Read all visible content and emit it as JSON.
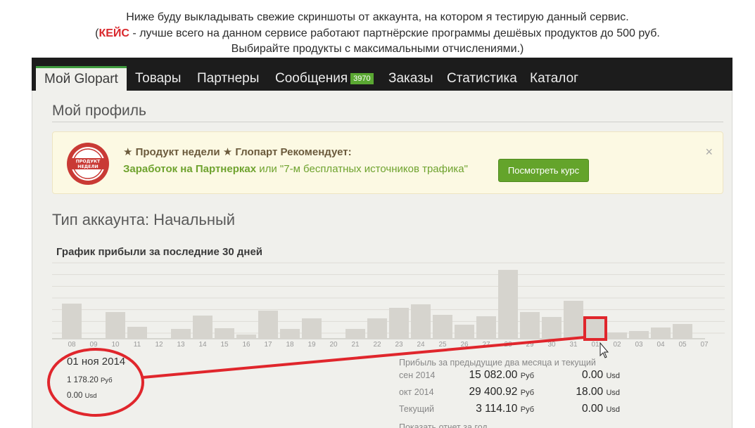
{
  "intro": {
    "line1": "Ниже буду выкладывать свежие скриншоты от аккаунта, на котором я тестирую данный сервис.",
    "line2_prefix": "(",
    "line2_keyword": "КЕЙС",
    "line2_rest": " - лучше всего на данном сервисе работают партнёрские программы дешёвых продуктов до 500 руб.",
    "line3": "Выбирайте продукты с максимальными отчислениями.)"
  },
  "nav": {
    "tabs": [
      {
        "label": "Мой Glopart",
        "active": true
      },
      {
        "label": "Товары"
      },
      {
        "label": "Партнеры"
      },
      {
        "label": "Сообщения",
        "badge": "3970"
      },
      {
        "label": "Заказы"
      },
      {
        "label": "Статистика"
      },
      {
        "label": "Каталог"
      }
    ]
  },
  "profile": {
    "title": "Мой профиль"
  },
  "banner": {
    "seal_text": [
      "ПРОДУКТ",
      "НЕДЕЛИ"
    ],
    "line1": "★ Продукт недели ★ Глопарт Рекомендует:",
    "link1": "Заработок на Партнерках",
    "mid": " или ",
    "link2": "\"7-м бесплатных источников трафика\"",
    "cta": "Посмотреть курс",
    "close": "×"
  },
  "account": {
    "type_label": "Тип аккаунта: Начальный"
  },
  "chart_title": "График прибыли за последние 30 дней",
  "chart_data": {
    "type": "bar",
    "categories": [
      "08",
      "09",
      "10",
      "11",
      "12",
      "13",
      "14",
      "15",
      "16",
      "17",
      "18",
      "19",
      "20",
      "21",
      "22",
      "23",
      "24",
      "25",
      "26",
      "27",
      "28",
      "29",
      "30",
      "31",
      "01",
      "02",
      "03",
      "04",
      "05",
      "07"
    ],
    "values": [
      50,
      0,
      38,
      17,
      0,
      14,
      33,
      15,
      6,
      40,
      14,
      29,
      0,
      14,
      29,
      44,
      49,
      34,
      20,
      32,
      98,
      38,
      31,
      54,
      29,
      9,
      11,
      16,
      21,
      0
    ],
    "highlight_index": 24,
    "bar_color": "#d6d4ce",
    "highlight_color": "#e0262c",
    "ylim": [
      0,
      100
    ],
    "grid": true
  },
  "day_detail": {
    "date": "01 ноя 2014",
    "rub": "1 178.20",
    "rub_unit": "Руб",
    "usd": "0.00",
    "usd_unit": "Usd"
  },
  "stats": {
    "title": "Прибыль за предыдущие два месяца и текущий",
    "rows": [
      {
        "label": "сен 2014",
        "rub": "15 082.00",
        "usd": "0.00"
      },
      {
        "label": "окт 2014",
        "rub": "29 400.92",
        "usd": "18.00"
      },
      {
        "label": "Текущий",
        "rub": "3 114.10",
        "usd": "0.00"
      }
    ],
    "rub_unit": "Руб",
    "usd_unit": "Usd",
    "report_link": "Показать отчет за год"
  },
  "colors": {
    "nav_bg": "#1c1c1c",
    "content_bg": "#f0f0ec",
    "accent_green": "#64a42b",
    "annotation_red": "#e0262c"
  }
}
